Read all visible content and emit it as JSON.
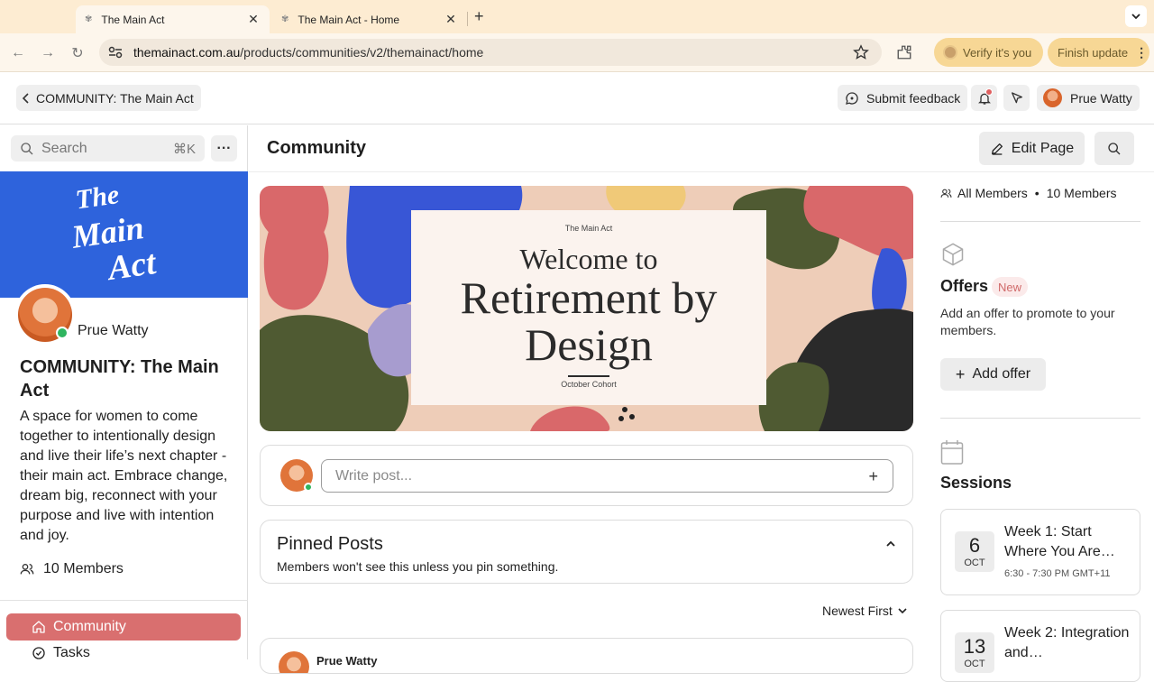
{
  "browser": {
    "tabs": [
      {
        "label": "The Main Act",
        "active": true
      },
      {
        "label": "The Main Act - Home",
        "active": false
      }
    ],
    "url_domain": "themainact.com.au",
    "url_path": "/products/communities/v2/themainact/home",
    "verify_label": "Verify it's you",
    "finish_update_label": "Finish update"
  },
  "header": {
    "back_label": "COMMUNITY: The Main Act",
    "feedback_label": "Submit feedback",
    "user_name": "Prue Watty"
  },
  "sidebar": {
    "search_placeholder": "Search",
    "search_shortcut": "⌘K",
    "banner_logo_lines": [
      "The",
      "Main",
      "Act"
    ],
    "owner_name": "Prue Watty",
    "community_title": "COMMUNITY: The Main Act",
    "description": "A space for women to come together to intentionally design and live their life’s next chapter - their main act. Embrace change, dream big, reconnect with your purpose and live with intention and joy.",
    "members_label": "10 Members",
    "nav": [
      {
        "label": "Community",
        "icon": "home-icon",
        "active": true
      },
      {
        "label": "Tasks",
        "icon": "tasks-icon",
        "active": false
      }
    ]
  },
  "main": {
    "page_title": "Community",
    "edit_label": "Edit Page",
    "hero": {
      "brand": "The Main Act",
      "line1": "Welcome to",
      "line2": "Retirement by",
      "line3": "Design",
      "cohort": "October Cohort"
    },
    "write_placeholder": "Write post...",
    "pinned": {
      "title": "Pinned Posts",
      "subtitle": "Members won't see this unless you pin something."
    },
    "sort_label": "Newest First",
    "first_post_author": "Prue Watty"
  },
  "right": {
    "all_members_label": "All Members",
    "members_count": "10 Members",
    "offers_title": "Offers",
    "offers_badge": "New",
    "offers_desc": "Add an offer to promote to your members.",
    "add_offer_label": "Add offer",
    "sessions_title": "Sessions",
    "sessions": [
      {
        "day": "6",
        "month": "OCT",
        "title": "Week 1: Start Where You Are…",
        "time": "6:30 - 7:30 PM GMT+11"
      },
      {
        "day": "13",
        "month": "OCT",
        "title": "Week 2: Integration and…",
        "time": ""
      }
    ]
  },
  "colors": {
    "accent": "#d96f6f",
    "banner_blue": "#2e63dc",
    "online_green": "#2fb55f",
    "chrome_tab_bg": "#fdecd2"
  }
}
